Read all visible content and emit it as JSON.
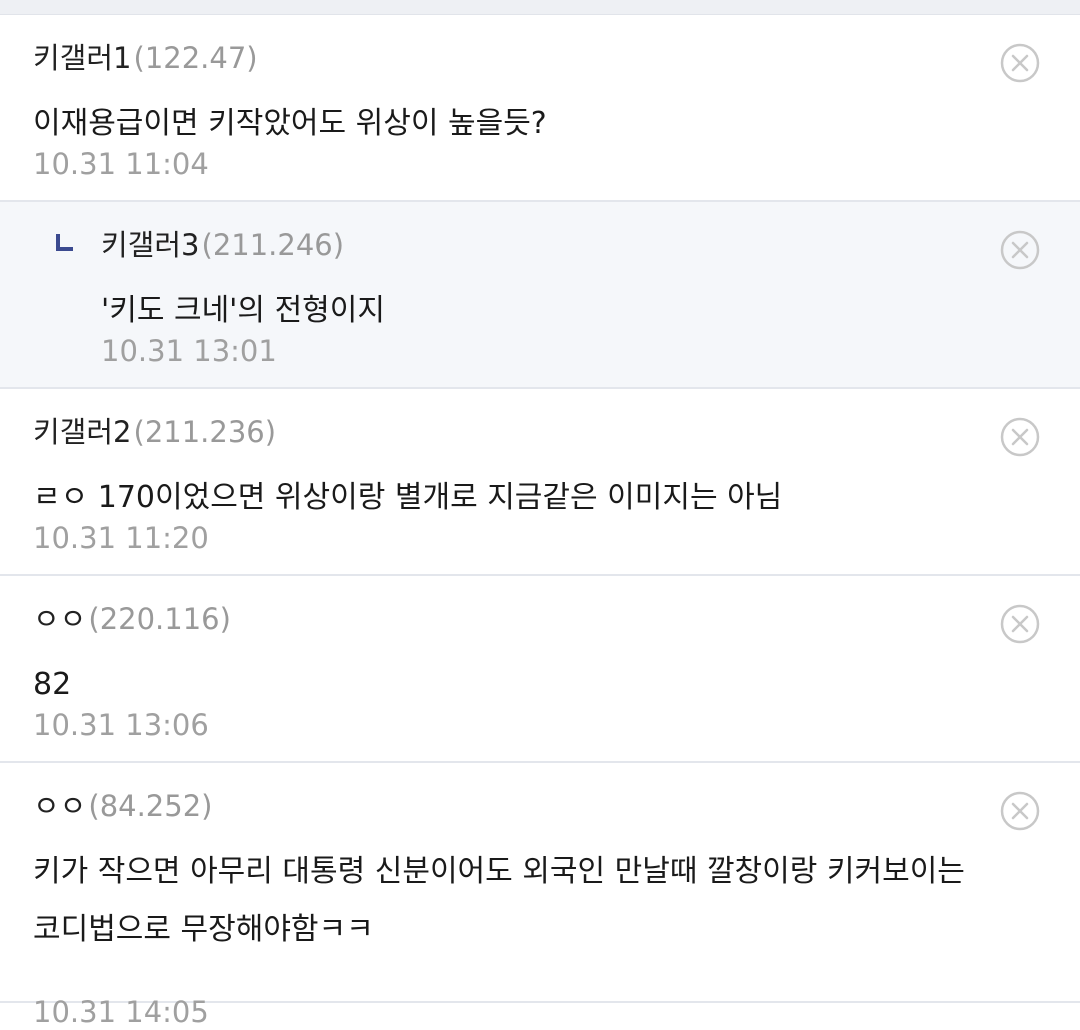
{
  "comments": [
    {
      "nickname": "키갤러1",
      "ip": "(122.47)",
      "text": "이재용급이면 키작았어도 위상이 높을듯?",
      "time": "10.31 11:04"
    },
    {
      "nickname": "키갤러3",
      "ip": "(211.246)",
      "text": "'키도 크네'의 전형이지",
      "time": "10.31 13:01",
      "is_reply": true
    },
    {
      "nickname": "키갤러2",
      "ip": "(211.236)",
      "text": "ㄹㅇ 170이었으면 위상이랑 별개로 지금같은 이미지는 아님",
      "time": "10.31 11:20"
    },
    {
      "nickname": "ㅇㅇ",
      "ip": "(220.116)",
      "text": "82",
      "time": "10.31 13:06"
    },
    {
      "nickname": "ㅇㅇ",
      "ip": "(84.252)",
      "text": "키가 작으면 아무리 대통령 신분이어도 외국인 만날때 깔창이랑 키커보이는 코디법으로 무장해야함ㅋㅋ",
      "time": "10.31 14:05"
    }
  ],
  "icons": {
    "delete": "close-circle-icon",
    "reply": "reply-arrow-icon"
  },
  "colors": {
    "reply_background": "#f5f7fa",
    "divider": "#e3e6ec",
    "muted_text": "#999999",
    "reply_icon": "#3b4a8f"
  }
}
